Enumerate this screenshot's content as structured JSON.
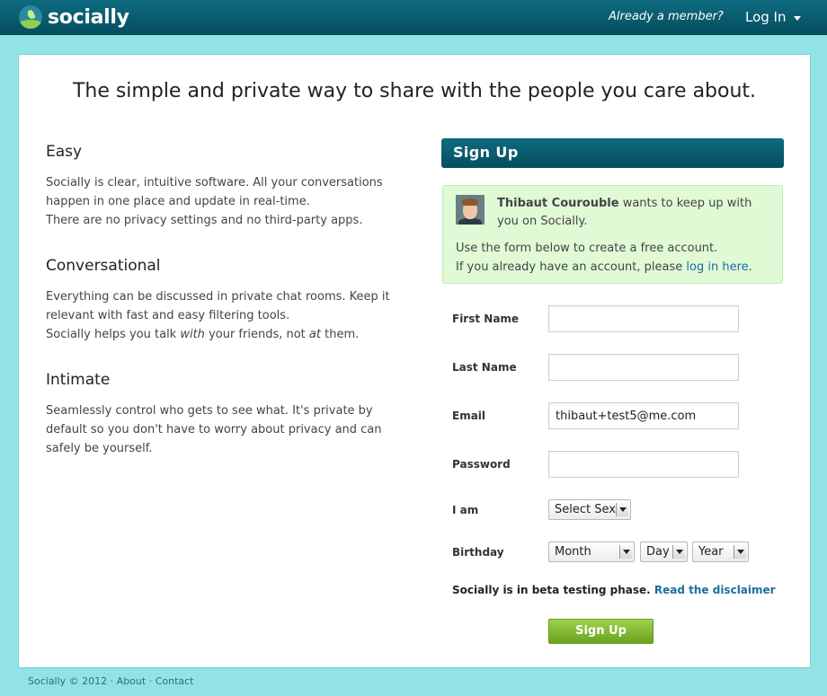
{
  "topbar": {
    "logo_text": "socially",
    "already_member": "Already a member?",
    "login_label": "Log In"
  },
  "headline": "The simple and private way to share with the people you care about.",
  "features": [
    {
      "title": "Easy",
      "lines": [
        "Socially is clear, intuitive software. All your conversations happen in one place and update in real-time.",
        "There are no privacy settings and no third-party apps."
      ]
    },
    {
      "title": "Conversational",
      "lines": [
        "Everything can be discussed in private chat rooms. Keep it relevant with fast and easy filtering tools."
      ],
      "line2": {
        "pre": "Socially helps you talk ",
        "em1": "with",
        "mid": " your friends, not ",
        "em2": "at",
        "post": " them."
      }
    },
    {
      "title": "Intimate",
      "lines": [
        "Seamlessly control who gets to see what. It's private by default so you don't have to worry about privacy and can safely be yourself."
      ]
    }
  ],
  "signup": {
    "header": "Sign Up",
    "invite": {
      "name": "Thibaut Courouble",
      "rest": " wants to keep up with you on Socially.",
      "line2": "Use the form below to create a free account.",
      "line3_pre": "If you already have an account, please ",
      "line3_link": "log in here",
      "line3_post": "."
    },
    "labels": {
      "first_name": "First Name",
      "last_name": "Last Name",
      "email": "Email",
      "password": "Password",
      "i_am": "I am",
      "birthday": "Birthday"
    },
    "values": {
      "first_name": "",
      "last_name": "",
      "email": "thibaut+test5@me.com",
      "password": ""
    },
    "selects": {
      "sex": "Select Sex",
      "month": "Month",
      "day": "Day",
      "year": "Year"
    },
    "beta_text": "Socially is in beta testing phase.",
    "beta_link": "Read the disclaimer",
    "button": "Sign Up"
  },
  "footer": {
    "copyright": "Socially © 2012",
    "sep": " · ",
    "about": "About",
    "contact": "Contact"
  }
}
